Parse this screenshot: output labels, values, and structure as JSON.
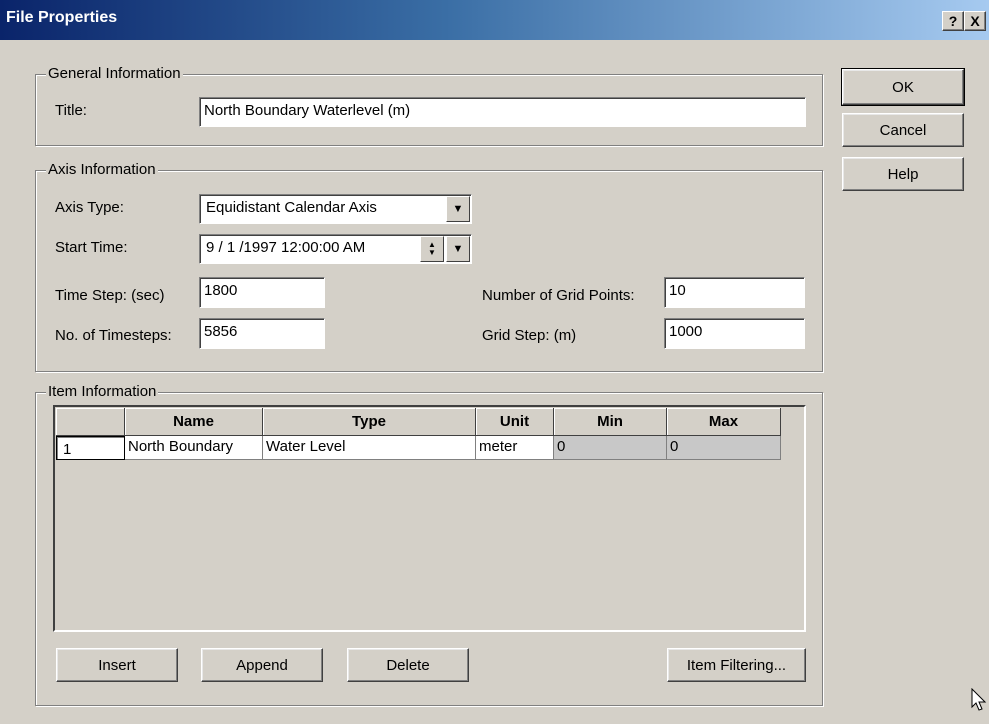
{
  "window": {
    "title": "File Properties",
    "help_label": "?",
    "close_label": "X"
  },
  "buttons": {
    "ok": "OK",
    "cancel": "Cancel",
    "help": "Help"
  },
  "general": {
    "group_label": "General Information",
    "title_label": "Title:",
    "title_value": "North Boundary Waterlevel (m)"
  },
  "axis": {
    "group_label": "Axis Information",
    "axis_type_label": "Axis Type:",
    "axis_type_value": "Equidistant Calendar Axis",
    "start_time_label": "Start Time:",
    "start_time_value": "9 / 1 /1997 12:00:00 AM",
    "time_step_label": "Time Step: (sec)",
    "time_step_value": "1800",
    "num_timesteps_label": "No. of Timesteps:",
    "num_timesteps_value": "5856",
    "grid_points_label": "Number of Grid Points:",
    "grid_points_value": "10",
    "grid_step_label": "Grid Step: (m)",
    "grid_step_value": "1000"
  },
  "items": {
    "group_label": "Item Information",
    "columns": [
      "Name",
      "Type",
      "Unit",
      "Min",
      "Max"
    ],
    "rows": [
      {
        "num": "1",
        "name": "North Boundary",
        "type": "Water Level",
        "unit": "meter",
        "min": "0",
        "max": "0"
      }
    ],
    "insert": "Insert",
    "append": "Append",
    "delete": "Delete",
    "filtering": "Item Filtering..."
  }
}
